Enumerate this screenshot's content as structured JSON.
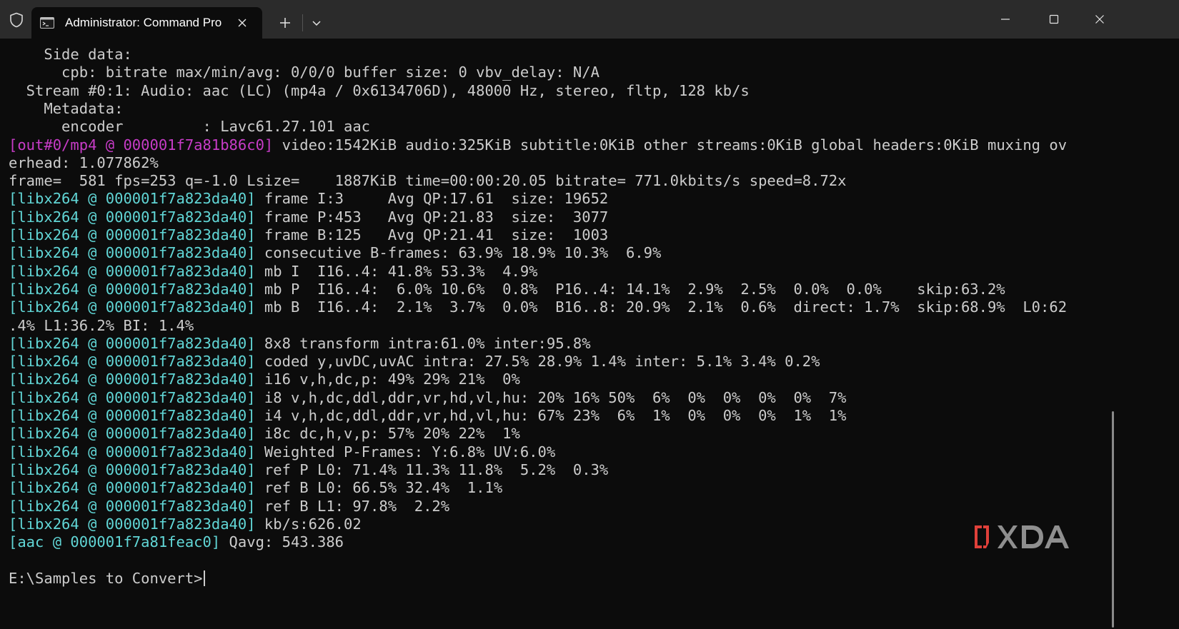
{
  "titlebar": {
    "tab_title": "Administrator: Command Pro",
    "icons": {
      "shield": "shield-icon",
      "terminal": "terminal-icon",
      "close_tab": "close-icon",
      "new_tab": "plus-icon",
      "dropdown": "chevron-down-icon",
      "minimize": "minimize-icon",
      "maximize": "maximize-icon",
      "close_window": "close-icon"
    }
  },
  "colors": {
    "background": "#0c0c0c",
    "titlebar": "#2b2b2b",
    "text": "#cccccc",
    "tag_cyan": "#61d6d6",
    "tag_magenta": "#c73cc7",
    "xda_red": "#e0403a"
  },
  "terminal": {
    "lines": [
      {
        "tag": "",
        "text": "    Side data:"
      },
      {
        "tag": "",
        "text": "      cpb: bitrate max/min/avg: 0/0/0 buffer size: 0 vbv_delay: N/A"
      },
      {
        "tag": "",
        "text": "  Stream #0:1: Audio: aac (LC) (mp4a / 0x6134706D), 48000 Hz, stereo, fltp, 128 kb/s"
      },
      {
        "tag": "",
        "text": "    Metadata:"
      },
      {
        "tag": "",
        "text": "      encoder         : Lavc61.27.101 aac"
      },
      {
        "tag": "[out#0/mp4 @ 000001f7a81b86c0]",
        "text": " video:1542KiB audio:325KiB subtitle:0KiB other streams:0KiB global headers:0KiB muxing ov"
      },
      {
        "tag": "",
        "text": "erhead: 1.077862%"
      },
      {
        "tag": "",
        "text": "frame=  581 fps=253 q=-1.0 Lsize=    1887KiB time=00:00:20.05 bitrate= 771.0kbits/s speed=8.72x"
      },
      {
        "tag": "[libx264 @ 000001f7a823da40]",
        "text": " frame I:3     Avg QP:17.61  size: 19652"
      },
      {
        "tag": "[libx264 @ 000001f7a823da40]",
        "text": " frame P:453   Avg QP:21.83  size:  3077"
      },
      {
        "tag": "[libx264 @ 000001f7a823da40]",
        "text": " frame B:125   Avg QP:21.41  size:  1003"
      },
      {
        "tag": "[libx264 @ 000001f7a823da40]",
        "text": " consecutive B-frames: 63.9% 18.9% 10.3%  6.9%"
      },
      {
        "tag": "[libx264 @ 000001f7a823da40]",
        "text": " mb I  I16..4: 41.8% 53.3%  4.9%"
      },
      {
        "tag": "[libx264 @ 000001f7a823da40]",
        "text": " mb P  I16..4:  6.0% 10.6%  0.8%  P16..4: 14.1%  2.9%  2.5%  0.0%  0.0%    skip:63.2%"
      },
      {
        "tag": "[libx264 @ 000001f7a823da40]",
        "text": " mb B  I16..4:  2.1%  3.7%  0.0%  B16..8: 20.9%  2.1%  0.6%  direct: 1.7%  skip:68.9%  L0:62"
      },
      {
        "tag": "",
        "text": ".4% L1:36.2% BI: 1.4%"
      },
      {
        "tag": "[libx264 @ 000001f7a823da40]",
        "text": " 8x8 transform intra:61.0% inter:95.8%"
      },
      {
        "tag": "[libx264 @ 000001f7a823da40]",
        "text": " coded y,uvDC,uvAC intra: 27.5% 28.9% 1.4% inter: 5.1% 3.4% 0.2%"
      },
      {
        "tag": "[libx264 @ 000001f7a823da40]",
        "text": " i16 v,h,dc,p: 49% 29% 21%  0%"
      },
      {
        "tag": "[libx264 @ 000001f7a823da40]",
        "text": " i8 v,h,dc,ddl,ddr,vr,hd,vl,hu: 20% 16% 50%  6%  0%  0%  0%  0%  7%"
      },
      {
        "tag": "[libx264 @ 000001f7a823da40]",
        "text": " i4 v,h,dc,ddl,ddr,vr,hd,vl,hu: 67% 23%  6%  1%  0%  0%  0%  1%  1%"
      },
      {
        "tag": "[libx264 @ 000001f7a823da40]",
        "text": " i8c dc,h,v,p: 57% 20% 22%  1%"
      },
      {
        "tag": "[libx264 @ 000001f7a823da40]",
        "text": " Weighted P-Frames: Y:6.8% UV:6.0%"
      },
      {
        "tag": "[libx264 @ 000001f7a823da40]",
        "text": " ref P L0: 71.4% 11.3% 11.8%  5.2%  0.3%"
      },
      {
        "tag": "[libx264 @ 000001f7a823da40]",
        "text": " ref B L0: 66.5% 32.4%  1.1%"
      },
      {
        "tag": "[libx264 @ 000001f7a823da40]",
        "text": " ref B L1: 97.8%  2.2%"
      },
      {
        "tag": "[libx264 @ 000001f7a823da40]",
        "text": " kb/s:626.02"
      },
      {
        "tag": "[aac @ 000001f7a81feac0]",
        "text": " Qavg: 543.386"
      },
      {
        "tag": "",
        "text": ""
      },
      {
        "tag": "",
        "text": "E:\\Samples to Convert>"
      }
    ]
  },
  "watermark": {
    "logo": "XDA"
  }
}
